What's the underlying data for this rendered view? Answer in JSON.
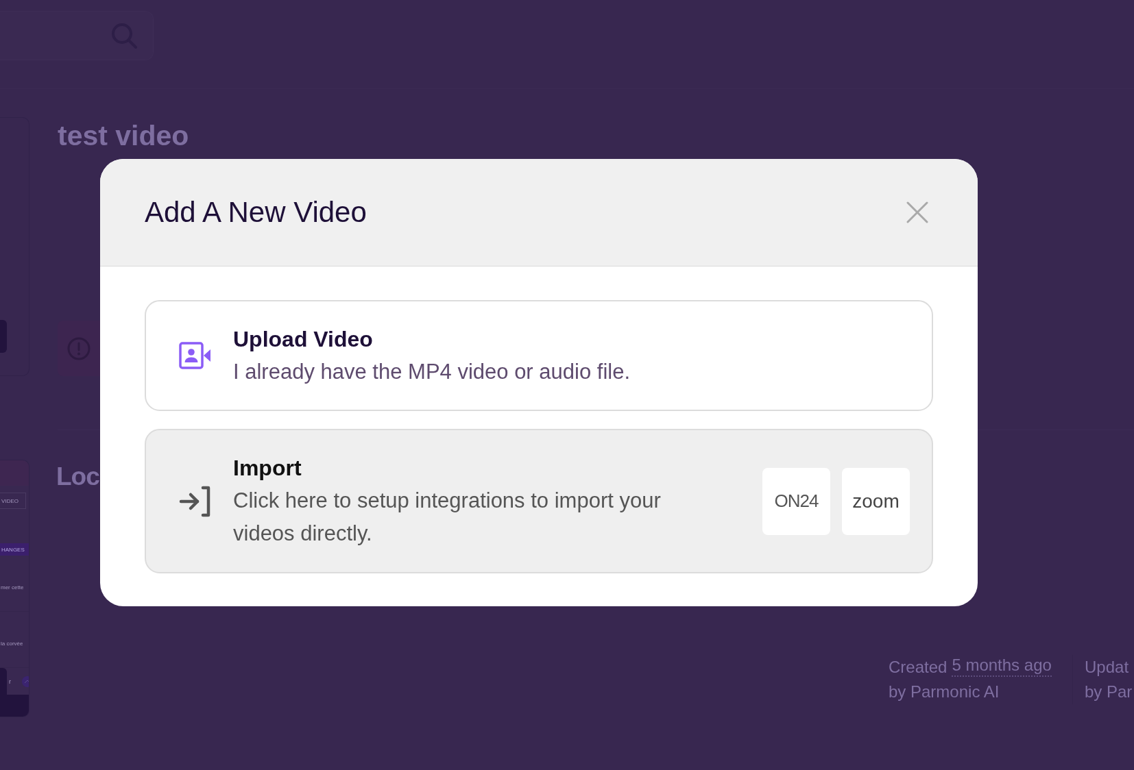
{
  "page": {
    "title": "test video",
    "section_heading": "Loc",
    "preview_panel": [
      {
        "kind": "button",
        "text": "VIDEO"
      },
      {
        "kind": "banner",
        "text": "HANGES"
      },
      {
        "kind": "row",
        "text": "mer cette"
      },
      {
        "kind": "row",
        "text": "la corvée"
      },
      {
        "kind": "footer",
        "text": "r"
      }
    ],
    "meta": [
      {
        "label": "Created",
        "time": "5 months ago",
        "author": "by Parmonic AI"
      },
      {
        "label": "Updat",
        "author": "by Par"
      }
    ]
  },
  "modal": {
    "title": "Add A New Video",
    "options": [
      {
        "kind": "upload",
        "title": "Upload Video",
        "description": "I already have the MP4 video or audio file."
      },
      {
        "kind": "import",
        "title": "Import",
        "description": "Click here to setup integrations to import your videos directly.",
        "integrations": [
          "ON24",
          "zoom"
        ]
      }
    ]
  }
}
